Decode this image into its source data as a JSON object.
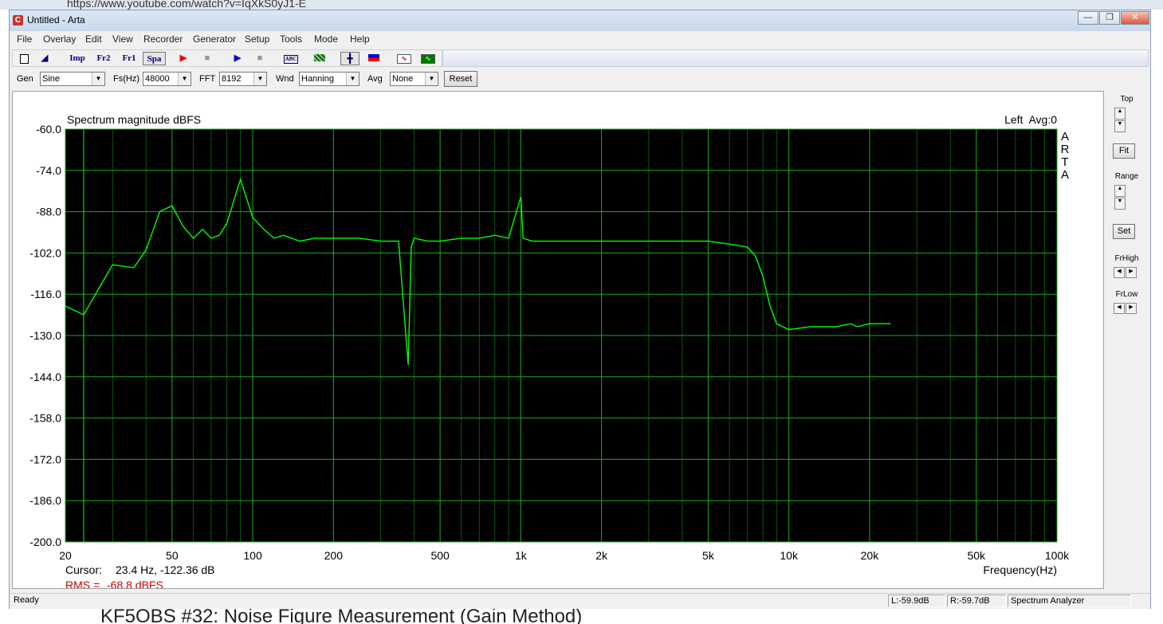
{
  "browser": {
    "url": "https://www.youtube.com/watch?v=IqXkS0yJ1-E",
    "bottom_text": "KF5OBS #32: Noise Figure Measurement (Gain Method)"
  },
  "window": {
    "title": "Untitled - Arta",
    "icon": "arta-app-icon"
  },
  "menu": [
    "File",
    "Overlay",
    "Edit",
    "View",
    "Recorder",
    "Generator",
    "Setup",
    "Tools",
    "Mode",
    "Help"
  ],
  "toolbar": {
    "imp": "Imp",
    "fr2": "Fr2",
    "fr1": "Fr1",
    "spa": "Spa"
  },
  "controls": {
    "gen_label": "Gen",
    "gen_value": "Sine",
    "fs_label": "Fs(Hz)",
    "fs_value": "48000",
    "fft_label": "FFT",
    "fft_value": "8192",
    "wnd_label": "Wnd",
    "wnd_value": "Hanning",
    "avg_label": "Avg",
    "avg_value": "None",
    "reset_label": "Reset"
  },
  "side": {
    "top_label": "Top",
    "fit_label": "Fit",
    "range_label": "Range",
    "set_label": "Set",
    "frhigh_label": "FrHigh",
    "frlow_label": "FrLow"
  },
  "chart_data": {
    "type": "line",
    "title": "Spectrum magnitude dBFS",
    "top_right": "Left  Avg:0",
    "watermark": [
      "A",
      "R",
      "T",
      "A"
    ],
    "xlabel": "Frequency(Hz)",
    "x_scale": "log",
    "xlim": [
      20,
      100000
    ],
    "ylim": [
      -200,
      -60
    ],
    "y_ticks": [
      -60.0,
      -74.0,
      -88.0,
      -102.0,
      -116.0,
      -130.0,
      -144.0,
      -158.0,
      -172.0,
      -186.0,
      -200.0
    ],
    "y_tick_labels": [
      "-60.0",
      "-74.0",
      "-88.0",
      "-102.0",
      "-116.0",
      "-130.0",
      "-144.0",
      "-158.0",
      "-172.0",
      "-186.0",
      "-200.0"
    ],
    "x_ticks": [
      20,
      50,
      100,
      200,
      500,
      1000,
      2000,
      5000,
      10000,
      20000,
      50000,
      100000
    ],
    "x_tick_labels": [
      "20",
      "50",
      "100",
      "200",
      "500",
      "1k",
      "2k",
      "5k",
      "10k",
      "20k",
      "50k",
      "100k"
    ],
    "cursor_x": 23.4,
    "grid": true,
    "background": "#000000",
    "line_color": "#00ff00",
    "grid_color": "#0a7a0a",
    "series": [
      {
        "x": [
          20,
          23.4,
          30,
          36,
          40,
          45,
          50,
          55,
          60,
          65,
          70,
          75,
          80,
          90,
          100,
          110,
          120,
          130,
          150,
          170,
          200,
          250,
          300,
          350,
          380,
          390,
          400,
          450,
          500,
          600,
          700,
          800,
          900,
          1000,
          1020,
          1100,
          1300,
          1600,
          2000,
          2500,
          3000,
          4000,
          5000,
          6000,
          7000,
          7500,
          8000,
          8500,
          9000,
          10000,
          12000,
          15000,
          17000,
          18000,
          20000,
          24000
        ],
        "y": [
          -120,
          -123,
          -106,
          -107,
          -101,
          -88,
          -86,
          -93,
          -97,
          -94,
          -97,
          -96,
          -92,
          -77,
          -90,
          -94,
          -97,
          -96,
          -98,
          -97,
          -97,
          -97,
          -98,
          -98,
          -140,
          -100,
          -97,
          -98,
          -98,
          -97,
          -97,
          -96,
          -97,
          -83,
          -97,
          -98,
          -98,
          -98,
          -98,
          -98,
          -98,
          -98,
          -98,
          -99,
          -100,
          -103,
          -110,
          -120,
          -126,
          -128,
          -127,
          -127,
          -126,
          -127,
          -126,
          -126
        ]
      }
    ]
  },
  "readout": {
    "cursor_label": "Cursor:",
    "cursor_value": "23.4 Hz, -122.36 dB",
    "rms_label": "RMS =",
    "rms_value": "-68.8 dBFS"
  },
  "status": {
    "ready": "Ready",
    "l_level": "L:-59.9dB",
    "r_level": "R:-59.7dB",
    "mode": "Spectrum Analyzer"
  },
  "colors": {
    "accent_red": "#cc0000",
    "title_grad": "#c8d8ec"
  }
}
